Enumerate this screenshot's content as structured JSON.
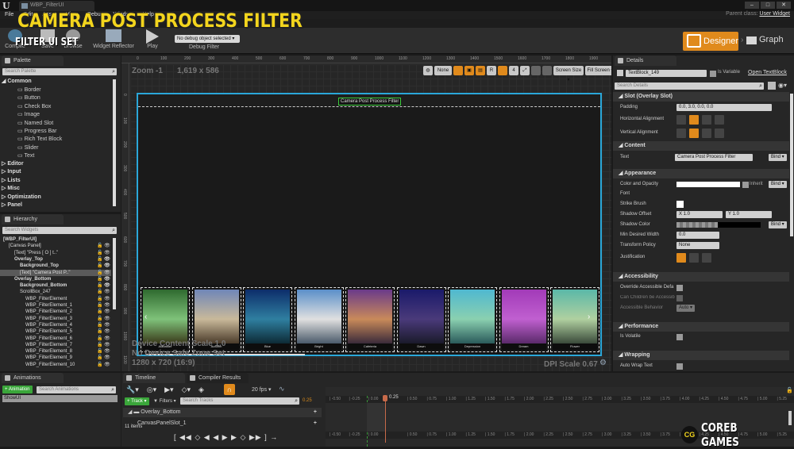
{
  "window": {
    "doc_tab": "WBP_FilterUI",
    "parent_class_label": "Parent class:",
    "parent_class_value": "User Widget",
    "controls": [
      "–",
      "□",
      "✕"
    ]
  },
  "overlay": {
    "title": "CAMERA POST PROCESS FILTER",
    "subtitle": "FILTER UI SET"
  },
  "menu": [
    "File",
    "Edit",
    "Asset",
    "View",
    "Debug",
    "Window",
    "Help"
  ],
  "toolbar": {
    "compile": "Compile",
    "save": "Save",
    "browse": "Browse",
    "widget_reflector": "Widget Reflector",
    "play": "Play",
    "debug_select": "No debug object selected ▾",
    "debug_label": "Debug Filter",
    "designer": "Designer",
    "graph": "Graph"
  },
  "palette": {
    "tab": "Palette",
    "search_placeholder": "Search Palette",
    "categories": [
      {
        "label": "Common",
        "items": [
          "Border",
          "Button",
          "Check Box",
          "Image",
          "Named Slot",
          "Progress Bar",
          "Rich Text Block",
          "Slider",
          "Text"
        ]
      }
    ],
    "collapsed": [
      "Editor",
      "Input",
      "Lists",
      "Misc",
      "Optimization",
      "Panel"
    ]
  },
  "hierarchy": {
    "tab": "Hierarchy",
    "search_placeholder": "Search Widgets",
    "rows": [
      {
        "label": "[WBP_FilterUI]",
        "depth": 0,
        "bold": true
      },
      {
        "label": "[Canvas Panel]",
        "depth": 1,
        "bold": false
      },
      {
        "label": "[Text] \"Press [ O ] t..\"",
        "depth": 2,
        "bold": false
      },
      {
        "label": "Overlay_Top",
        "depth": 2,
        "bold": true
      },
      {
        "label": "Background_Top",
        "depth": 3,
        "bold": true
      },
      {
        "label": "[Text] \"Camera Post P..\"",
        "depth": 3,
        "bold": false,
        "selected": true
      },
      {
        "label": "Overlay_Bottom",
        "depth": 2,
        "bold": true
      },
      {
        "label": "Background_Bottom",
        "depth": 3,
        "bold": true
      },
      {
        "label": "ScrollBox_247",
        "depth": 3,
        "bold": false
      },
      {
        "label": "WBP_FilterElement",
        "depth": 4
      },
      {
        "label": "WBP_FilterElement_1",
        "depth": 4
      },
      {
        "label": "WBP_FilterElement_2",
        "depth": 4
      },
      {
        "label": "WBP_FilterElement_3",
        "depth": 4
      },
      {
        "label": "WBP_FilterElement_4",
        "depth": 4
      },
      {
        "label": "WBP_FilterElement_5",
        "depth": 4
      },
      {
        "label": "WBP_FilterElement_6",
        "depth": 4
      },
      {
        "label": "WBP_FilterElement_7",
        "depth": 4
      },
      {
        "label": "WBP_FilterElement_8",
        "depth": 4
      },
      {
        "label": "WBP_FilterElement_9",
        "depth": 4
      },
      {
        "label": "WBP_FilterElement_10",
        "depth": 4
      }
    ]
  },
  "designer": {
    "zoom": "Zoom -1",
    "size": "1,619 x 586",
    "ruler_top": [
      "0",
      "100",
      "200",
      "300",
      "400",
      "500",
      "600",
      "700",
      "800",
      "900",
      "1000",
      "1100",
      "1200",
      "1300",
      "1400",
      "1500",
      "1600",
      "1700",
      "1800",
      "1900"
    ],
    "ruler_left": [
      "0",
      "100",
      "200",
      "300",
      "400",
      "500",
      "600",
      "700",
      "800",
      "900",
      "1000",
      "1100"
    ],
    "view_toolbar": {
      "none": "None",
      "r": "R",
      "grid_snap": "4",
      "screen_size": "Screen Size ▾",
      "fill_screen": "Fill Screen ▾"
    },
    "title_text": "Camera Post Process Filter",
    "filters": [
      {
        "label": "Alabaster",
        "colors": [
          "#2f6a2f",
          "#7fc27a",
          "#3a3a1a"
        ]
      },
      {
        "label": "Autumn",
        "colors": [
          "#6f86b8",
          "#c9b99a",
          "#4a3b2a"
        ]
      },
      {
        "label": "Blue",
        "colors": [
          "#0d2d6a",
          "#2f7fa0",
          "#0d2a35"
        ]
      },
      {
        "label": "Bright",
        "colors": [
          "#5a8fc9",
          "#e0e0e0",
          "#4a5a6a"
        ]
      },
      {
        "label": "Cafeteria",
        "colors": [
          "#6a3a8a",
          "#c98a5a",
          "#3a2a3a"
        ]
      },
      {
        "label": "Dawn",
        "colors": [
          "#1a1a6a",
          "#4a3a7a",
          "#1a1a2a"
        ]
      },
      {
        "label": "Depression",
        "colors": [
          "#4fb8d0",
          "#8ad0b0",
          "#2a5a5a"
        ]
      },
      {
        "label": "Dream",
        "colors": [
          "#a23ab8",
          "#c060d0",
          "#5a2a6a"
        ]
      },
      {
        "label": "Flower",
        "colors": [
          "#5ab8a8",
          "#b0d0a0",
          "#3a4a3a"
        ]
      }
    ],
    "device_info": [
      "Device Content Scale 1.0",
      "No Device Safe Zone Set",
      "1280 x 720 (16:9)"
    ],
    "dpi": "DPI Scale 0.67"
  },
  "details": {
    "tab": "Details",
    "name": "TextBlock_149",
    "is_variable": "Is Variable",
    "open": "Open TextBlock",
    "search_placeholder": "Search Details",
    "slot_section": "Slot (Overlay Slot)",
    "padding_label": "Padding",
    "padding_value": "0.0, 3.0, 0.0, 0.0",
    "h_align_label": "Horizontal Alignment",
    "v_align_label": "Vertical Alignment",
    "content_section": "Content",
    "text_label": "Text",
    "text_value": "Camera Post Process Filter",
    "bind": "Bind ▾",
    "appearance_section": "Appearance",
    "color_label": "Color and Opacity",
    "inherit": "Inherit",
    "font_label": "Font",
    "strike_label": "Strike Brush",
    "shadow_offset_label": "Shadow Offset",
    "shadow_x": "X  1.0",
    "shadow_y": "Y  1.0",
    "shadow_color_label": "Shadow Color",
    "min_width_label": "Min Desired Width",
    "min_width_value": "0.0",
    "transform_label": "Transform Policy",
    "transform_value": "None",
    "justification_label": "Justification",
    "accessibility_section": "Accessibility",
    "override_label": "Override Accessible Defa",
    "children_label": "Can Children be Accessib",
    "behavior_label": "Accessible Behavior",
    "behavior_value": "Auto ▾",
    "performance_section": "Performance",
    "volatile_label": "Is Volatile",
    "wrapping_section": "Wrapping",
    "autowrap_label": "Auto Wrap Text"
  },
  "animations": {
    "tab": "Animations",
    "add": "+ Animation",
    "search_placeholder": "Search Animations",
    "items": [
      "ShowUI"
    ]
  },
  "timeline": {
    "tab": "Timeline",
    "compiler_tab": "Compiler Results",
    "fps": "20 fps ▾",
    "track": "+ Track ▾",
    "filters": "▼ Filters ▾",
    "search_placeholder": "Search Tracks",
    "time": "0.25",
    "tracks": [
      "Overlay_Bottom",
      "CanvasPanelSlot_1"
    ],
    "items_count": "11 items",
    "ticks": [
      "-0.50",
      "-0.25",
      "0.00",
      "0.50",
      "0.75",
      "1.00",
      "1.25",
      "1.50",
      "1.75",
      "2.00",
      "2.25",
      "2.50",
      "2.75",
      "3.00",
      "3.25",
      "3.50",
      "3.75",
      "4.00",
      "4.25",
      "4.50",
      "4.75",
      "5.00",
      "5.25"
    ],
    "playhead": "0.25"
  },
  "watermark": {
    "logo": "CG",
    "text": "COREB GAMES"
  }
}
